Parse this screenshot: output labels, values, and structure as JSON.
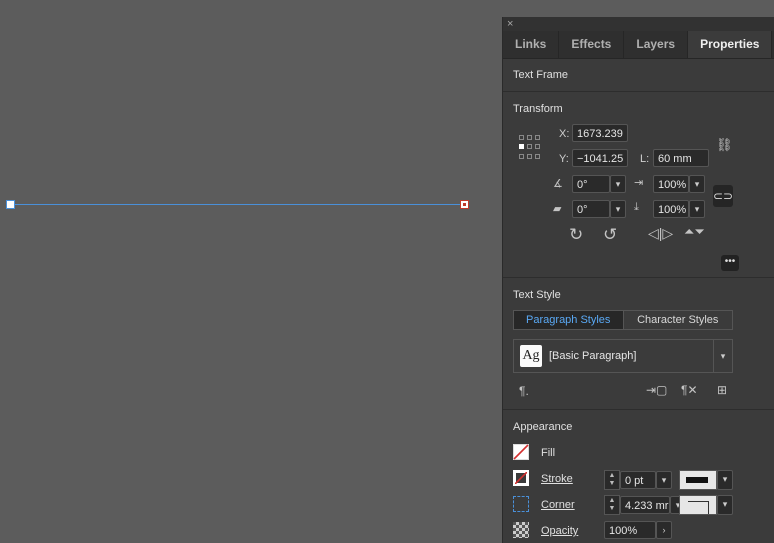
{
  "panel": {
    "close": "×",
    "tabs": [
      "Links",
      "Effects",
      "Layers",
      "Properties"
    ],
    "active_tab": "Properties"
  },
  "text_frame": {
    "title": "Text Frame"
  },
  "transform": {
    "title": "Transform",
    "x_label": "X:",
    "x_value": "1673.239",
    "y_label": "Y:",
    "y_value": "−1041.25",
    "l_label": "L:",
    "l_value": "60 mm",
    "rotation_value": "0°",
    "shear_value": "0°",
    "scale_x_value": "100%",
    "scale_y_value": "100%"
  },
  "text_style": {
    "title": "Text Style",
    "tab_paragraph": "Paragraph Styles",
    "tab_character": "Character Styles",
    "preview": "Ag",
    "paragraph_style": "[Basic Paragraph]"
  },
  "appearance": {
    "title": "Appearance",
    "fill_label": "Fill",
    "stroke_label": "Stroke",
    "stroke_value": "0 pt",
    "corner_label": "Corner",
    "corner_value": "4.233 mr",
    "opacity_label": "Opacity",
    "opacity_value": "100%"
  },
  "colors": {
    "accent": "#5aa9f5",
    "selection": "#4a90d9"
  }
}
